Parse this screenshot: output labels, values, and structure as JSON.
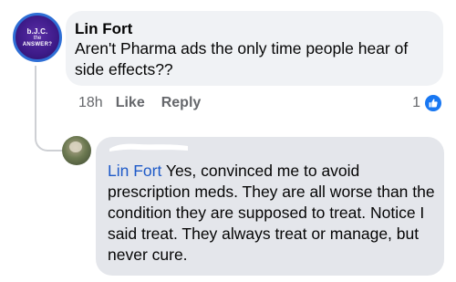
{
  "comment1": {
    "author": "Lin Fort",
    "text": "Aren't Pharma ads the only time people hear of side effects??",
    "avatar": {
      "line1": "b.J.C.",
      "line2": "the",
      "line3": "ANSWER?"
    },
    "time": "18h",
    "like_label": "Like",
    "reply_label": "Reply",
    "reaction_count": "1"
  },
  "comment2": {
    "author_redacted": true,
    "mention": "Lin Fort",
    "text": " Yes, convinced me to avoid prescription meds. They are all worse than the condition they are supposed to treat. Notice I said treat.  They always treat or manage, but never cure."
  },
  "colors": {
    "like_blue": "#1877f2",
    "mention_blue": "#1e5ac8",
    "bubble_gray": "#f0f2f5",
    "reply_bubble_gray": "#e4e6eb",
    "secondary_text": "#65676b"
  }
}
